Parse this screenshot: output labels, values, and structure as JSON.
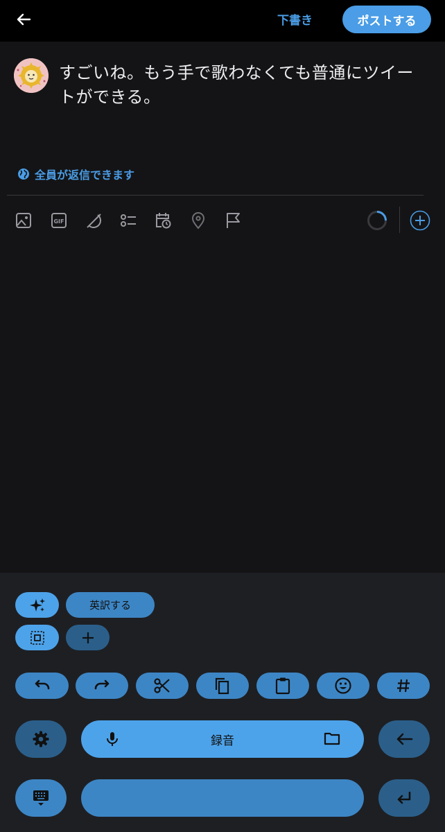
{
  "header": {
    "draft_label": "下書き",
    "post_label": "ポストする"
  },
  "compose": {
    "text": "すごいね。もう手で歌わなくても普通にツイートができる。",
    "reply_setting": "全員が返信できます",
    "toolbar": [
      "image-icon",
      "gif-icon",
      "grok-icon",
      "poll-icon",
      "schedule-icon",
      "location-icon",
      "flag-icon"
    ]
  },
  "keyboard": {
    "suggestion_translate": "英訳する",
    "spacebar_label": "録音"
  },
  "colors": {
    "accent": "#4a9de6",
    "keyboard_light": "#4da3ea",
    "keyboard_mid": "#3d86c5",
    "keyboard_dark": "#2b5f8a"
  }
}
